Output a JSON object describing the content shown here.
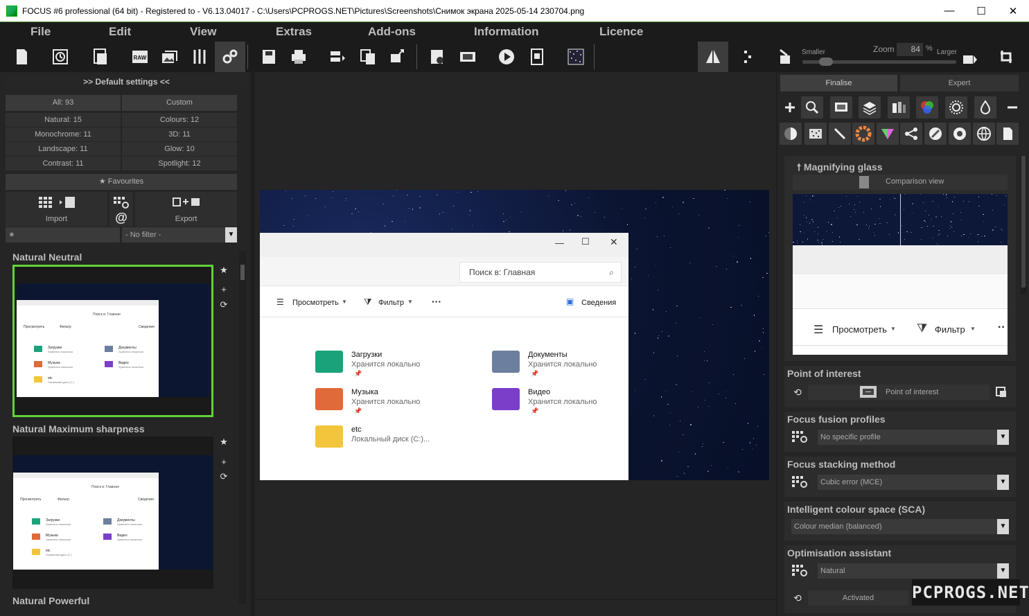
{
  "window": {
    "title": "FOCUS #6 professional (64 bit) - Registered to - V6.13.04017 - C:\\Users\\PCPROGS.NET\\Pictures\\Screenshots\\Снимок экрана 2025-05-14 230704.png",
    "minimize": "—",
    "maximize": "☐",
    "close": "✕"
  },
  "menu": [
    "File",
    "Edit",
    "View",
    "Extras",
    "Add-ons",
    "Information",
    "Licence"
  ],
  "toolbar": {
    "zoom_label": "Zoom",
    "zoom_value": "84",
    "zoom_unit": "%",
    "smaller": "Smaller",
    "larger": "Larger",
    "zoom_slider_fraction": 0.12
  },
  "left": {
    "header": ">> Default settings <<",
    "categories": {
      "all": "All: 93",
      "custom": "Custom",
      "natural": "Natural: 15",
      "colours": "Colours: 12",
      "monochrome": "Monochrome: 11",
      "three_d": "3D: 11",
      "landscape": "Landscape: 11",
      "glow": "Glow: 10",
      "contrast": "Contrast: 11",
      "spotlight": "Spotlight: 12"
    },
    "favourites": "Favourites",
    "import": "Import",
    "export": "Export",
    "filter": "- No filter -",
    "presets": [
      "Natural Neutral",
      "Natural Maximum sharpness",
      "Natural Powerful"
    ]
  },
  "explorer": {
    "search_placeholder": "Поиск в: Главная",
    "view_btn": "Просмотреть",
    "filter_btn": "Фильтр",
    "more": "···",
    "details": "Сведения",
    "folders": [
      {
        "name": "Загрузки",
        "sub": "Хранится локально",
        "color": "#1aa37a"
      },
      {
        "name": "Документы",
        "sub": "Хранится локально",
        "color": "#6d7f9e"
      },
      {
        "name": "Музыка",
        "sub": "Хранится локально",
        "color": "#e06a3a"
      },
      {
        "name": "Видео",
        "sub": "Хранится локально",
        "color": "#7a3ec9"
      },
      {
        "name": "etc",
        "sub": "Локальный диск (C:)...",
        "color": "#f2c53d"
      }
    ]
  },
  "mini_explorer": {
    "search": "Поиск в: Главная",
    "view": "Просмотреть",
    "filter": "Фильтр",
    "details": "Сведения",
    "folders": [
      "Загрузки",
      "Документы",
      "Музыка",
      "Видео",
      "etc"
    ],
    "subs": [
      "Хранится локально",
      "Хранится локально",
      "Хранится локально",
      "Хранится локально",
      "Локальный диск (C:)"
    ]
  },
  "right": {
    "tabs": [
      "Finalise",
      "Expert"
    ],
    "magnifier_title": "Magnifying glass",
    "comparison_view": "Comparison view",
    "mag_view_btn": "Просмотреть",
    "mag_filter_btn": "Фильтр",
    "mag_more": "··",
    "poi_title": "Point of interest",
    "poi_field": "Point of interest",
    "ff_title": "Focus fusion profiles",
    "ff_value": "No specific profile",
    "fs_title": "Focus stacking method",
    "fs_value": "Cubic error (MCE)",
    "ics_title": "Intelligent colour space (SCA)",
    "ics_value": "Colour median (balanced)",
    "opt_title": "Optimisation assistant",
    "opt_value": "Natural",
    "activated": "Activated"
  },
  "watermark": "PCPROGS.NET",
  "colors": {
    "accent_green": "#62d23a",
    "panel": "#252525",
    "sky": "#0b1430"
  }
}
